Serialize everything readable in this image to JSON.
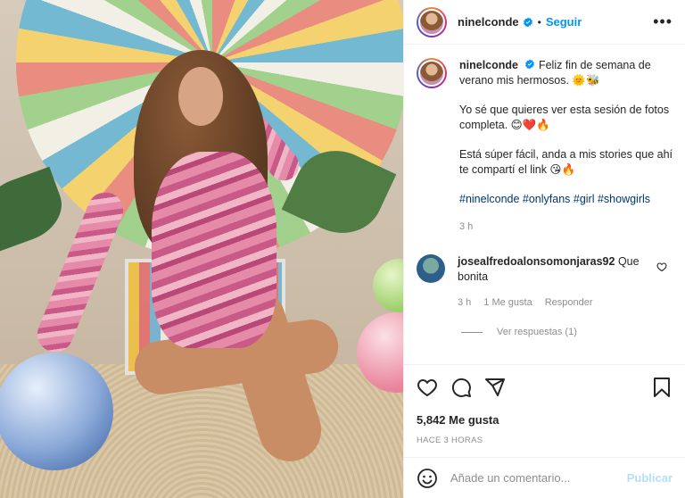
{
  "post": {
    "username": "ninelconde",
    "follow_label": "Seguir",
    "dot": "•",
    "more_label": "•••",
    "image_alt": "Foto de la publicación"
  },
  "caption": {
    "username": "ninelconde",
    "p1": "Feliz fin de semana de verano mis hermosos. 🌞🐝",
    "p2": "Yo sé que quieres ver esta sesión de fotos completa. 😊❤️🔥",
    "p3": "Está súper fácil, anda a mis stories que ahí te compartí el link 😘🔥",
    "hashtags": "#ninelconde #onlyfans #girl #showgirls",
    "time": "3 h"
  },
  "comments": [
    {
      "username": "josealfredoalonsomonjaras92",
      "text": "Que bonita",
      "time": "3 h",
      "likes": "1 Me gusta",
      "reply_label": "Responder",
      "view_replies": "Ver respuestas (1)"
    }
  ],
  "stats": {
    "likes": "5,842 Me gusta",
    "when": "HACE 3 HORAS"
  },
  "composer": {
    "placeholder": "Añade un comentario...",
    "publish_label": "Publicar"
  },
  "colors": {
    "accent": "#0095f6",
    "publish_disabled": "#b2dffc",
    "hashtag": "#00376b",
    "muted": "#8e8e8e"
  },
  "icons": [
    "verified-badge-icon",
    "more-options-icon",
    "heart-icon",
    "comment-icon",
    "share-icon",
    "bookmark-icon",
    "emoji-icon",
    "small-heart-icon"
  ]
}
